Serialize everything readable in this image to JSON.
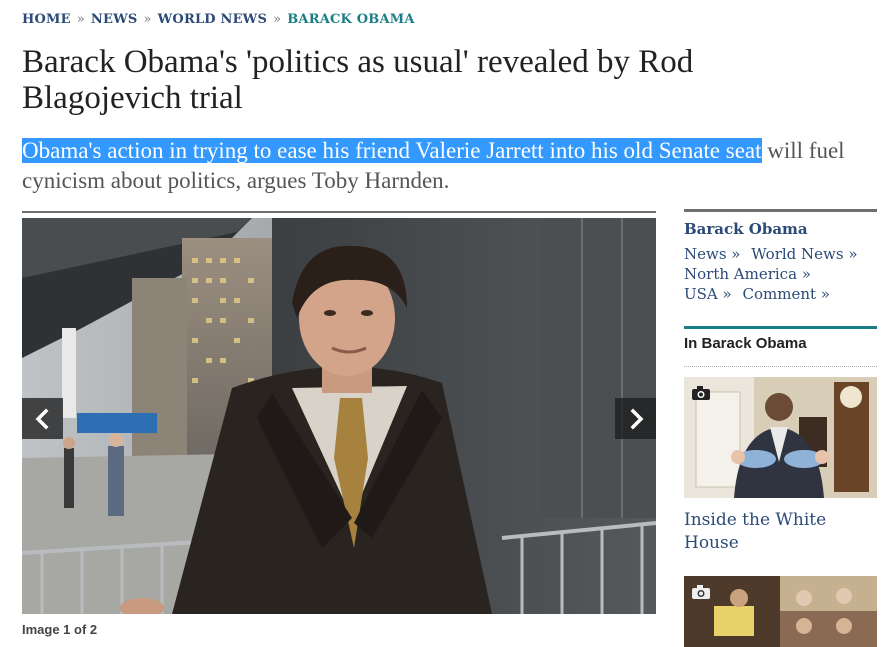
{
  "breadcrumb": {
    "items": [
      "HOME",
      "NEWS",
      "WORLD NEWS",
      "BARACK OBAMA"
    ],
    "separator": "»"
  },
  "article": {
    "headline": "Barack Obama's 'politics as usual' revealed by Rod Blagojevich trial",
    "standfirst_selected": "Obama's action in trying to ease his friend Valerie Jarrett into his old Senate seat",
    "standfirst_rest": " will fuel cynicism about politics, argues Toby Harnden.",
    "image_caption": "Image 1 of 2"
  },
  "gallery": {
    "prev_icon": "chevron-left-icon",
    "next_icon": "chevron-right-icon"
  },
  "sidebar": {
    "section_title": "Barack Obama",
    "links": [
      "News »",
      "World News »",
      "North America »",
      "USA »",
      "Comment »"
    ],
    "in_section_title": "In Barack Obama",
    "teaser_title": "Inside the White House",
    "camera_icon": "camera-icon"
  },
  "colors": {
    "link": "#2b4a78",
    "accent": "#1b7e86",
    "selection": "#3399ff"
  }
}
